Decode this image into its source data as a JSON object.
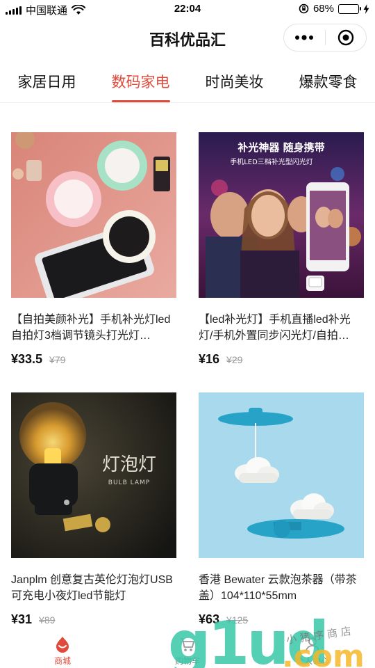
{
  "status_bar": {
    "carrier": "中国联通",
    "time": "22:04",
    "battery_pct": "68%",
    "battery_level": 0.68,
    "colors": {
      "battery": "#2ec13b"
    }
  },
  "nav": {
    "title": "百科优品汇",
    "more_icon": "more-dots-icon",
    "close_icon": "target-close-icon"
  },
  "tabs": [
    {
      "label": "家居日用",
      "active": false
    },
    {
      "label": "数码家电",
      "active": true
    },
    {
      "label": "时尚美妆",
      "active": false
    },
    {
      "label": "爆款零食",
      "active": false
    }
  ],
  "products": [
    {
      "title": "【自拍美颜补光】手机补光灯led自拍灯3档调节镜头打光灯…",
      "price": "¥33.5",
      "original_price": "¥79",
      "image": "selfie-ring-light"
    },
    {
      "title": "【led补光灯】手机直播led补光灯/手机外置同步闪光灯/自拍…",
      "price": "¥16",
      "original_price": "¥29",
      "image": "party-flash-light",
      "image_text": [
        "补光神器 随身携带",
        "手机LED三档补光型闪光灯"
      ]
    },
    {
      "title": "Janplm 创意复古英伦灯泡灯USB可充电小夜灯led节能灯",
      "price": "¥31",
      "original_price": "¥89",
      "image": "bulb-lamp",
      "image_text": [
        "灯泡灯",
        "BULB LAMP"
      ]
    },
    {
      "title": "香港 Bewater 云款泡茶器（带茶盖）104*110*55mm",
      "price": "¥63",
      "original_price": "¥125",
      "image": "cloud-tea-infuser"
    }
  ],
  "tabbar": [
    {
      "label": "商城",
      "icon": "shop-drop-icon",
      "active": true
    },
    {
      "label": "购物车",
      "icon": "cart-icon",
      "active": false
    },
    {
      "label": "个人中心",
      "icon": "user-icon",
      "active": false
    }
  ],
  "watermark": {
    "text": "g1ud.com",
    "sub": "小 猪 序 商 店"
  },
  "colors": {
    "accent": "#e04a3a",
    "text": "#222222",
    "muted": "#999999"
  }
}
